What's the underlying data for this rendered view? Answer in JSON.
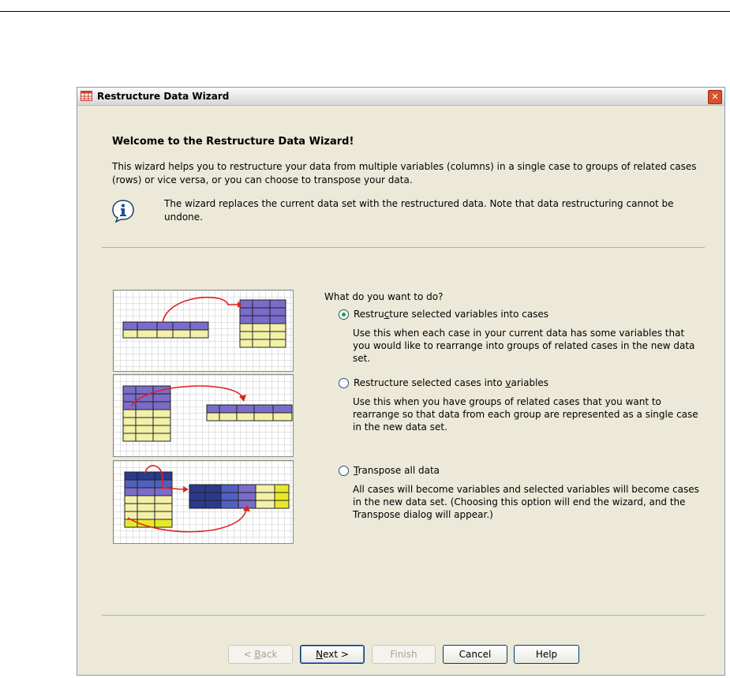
{
  "window": {
    "title": "Restructure Data Wizard",
    "icon": "data-grid-icon",
    "close_icon": "close-x-icon",
    "close_glyph": "✕"
  },
  "content": {
    "welcome_title": "Welcome to the Restructure Data Wizard!",
    "intro_text": "This wizard helps you to restructure your data from multiple variables (columns) in a single case to groups of related cases (rows) or vice versa, or you can choose to transpose your data.",
    "info_icon": "info-icon",
    "info_text": "The wizard replaces the current data set with the restructured data. Note that data restructuring cannot be undone."
  },
  "question": "What do you want to do?",
  "options": [
    {
      "label_pre": "Restru",
      "label_u": "c",
      "label_post": "ture selected variables into cases",
      "description": "Use this when each case in your current data has some variables that you would like to rearrange into groups of related cases in the new data set.",
      "selected": true
    },
    {
      "label_pre": "Restructure selected cases into ",
      "label_u": "v",
      "label_post": "ariables",
      "description": "Use this when you have groups of related cases that you want to rearrange so that data from each group are represented as a single case in the new data set.",
      "selected": false
    },
    {
      "label_pre": "",
      "label_u": "T",
      "label_post": "ranspose all data",
      "description": "All cases will become variables and selected variables will become cases in the new data set. (Choosing this option will end the wizard, and the Transpose dialog will appear.)",
      "selected": false
    }
  ],
  "buttons": {
    "back_pre": "< ",
    "back_u": "B",
    "back_post": "ack",
    "next_u": "N",
    "next_post": "ext >",
    "finish": "Finish",
    "cancel": "Cancel",
    "help": "Help"
  },
  "colors": {
    "accent_purple": "#7a6cc8",
    "accent_yellow": "#f3f0a8",
    "accent_dark_blue": "#2a3a8c",
    "accent_bright_yellow": "#e8e82a",
    "arrow_red": "#e02020"
  }
}
